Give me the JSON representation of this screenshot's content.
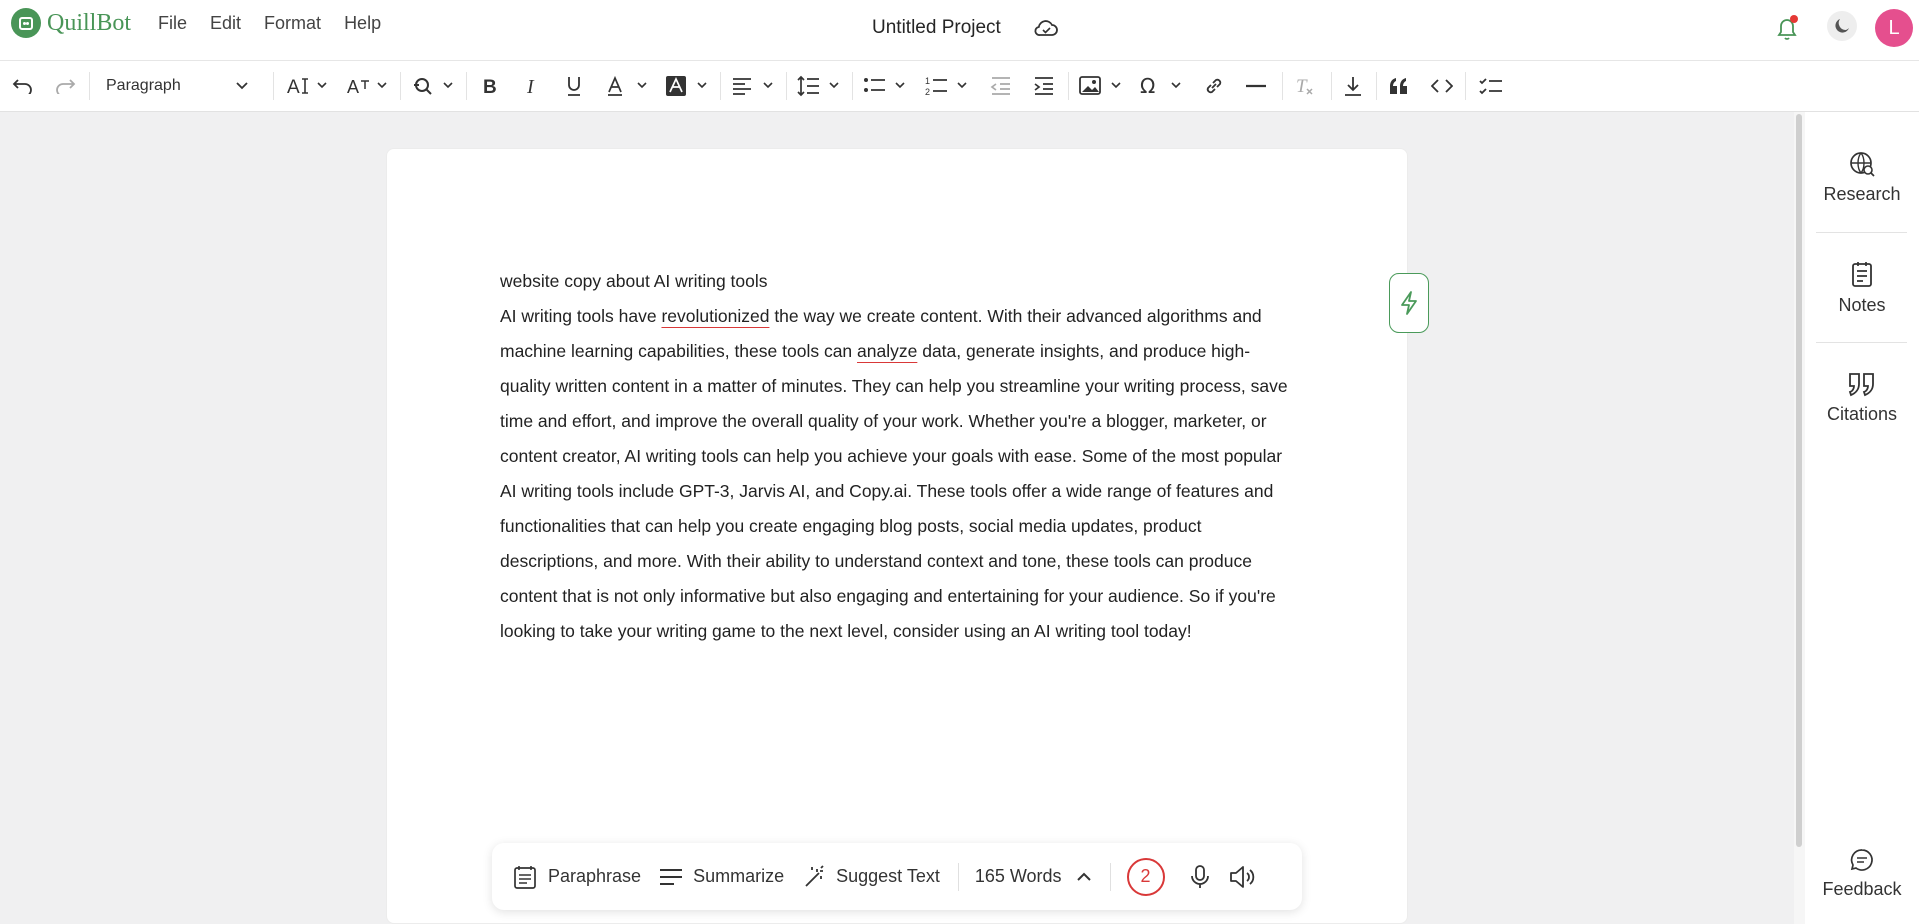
{
  "app": {
    "brand": "QuillBot",
    "accent_color": "#499557"
  },
  "menu": [
    "File",
    "Edit",
    "Format",
    "Help"
  ],
  "project": {
    "title": "Untitled Project"
  },
  "user": {
    "avatar_initial": "L",
    "avatar_color": "#e54f8e"
  },
  "toolbar": {
    "block_style": "Paragraph"
  },
  "sidebar": {
    "items": [
      {
        "label": "Research",
        "icon": "globe-search-icon"
      },
      {
        "label": "Notes",
        "icon": "notes-icon"
      },
      {
        "label": "Citations",
        "icon": "quote-icon"
      }
    ],
    "feedback_label": "Feedback"
  },
  "document": {
    "heading": "website copy about AI writing tools",
    "body_parts": [
      " AI writing tools have ",
      "revolutionized",
      " the way we create content. With their advanced algorithms and machine learning capabilities, these tools can ",
      "analyze",
      " data, generate insights, and produce high-quality written content in a matter of minutes. They can help you streamline your writing process, save time and effort, and improve the overall quality of your work. Whether you're a blogger, marketer, or content creator, AI writing tools can help you achieve your goals with ease. Some of the most popular AI writing tools include GPT-3, Jarvis AI, and Copy.ai. These tools offer a wide range of features and functionalities that can help you create engaging blog posts, social media updates, product descriptions, and more. With their ability to understand context and tone, these tools can produce content that is not only informative but also engaging and entertaining for your audience. So if you're looking to take your writing game to the next level, consider using an AI writing tool today!"
    ]
  },
  "actionbar": {
    "paraphrase": "Paraphrase",
    "summarize": "Summarize",
    "suggest": "Suggest Text",
    "word_count": "165 Words",
    "issues": "2"
  }
}
